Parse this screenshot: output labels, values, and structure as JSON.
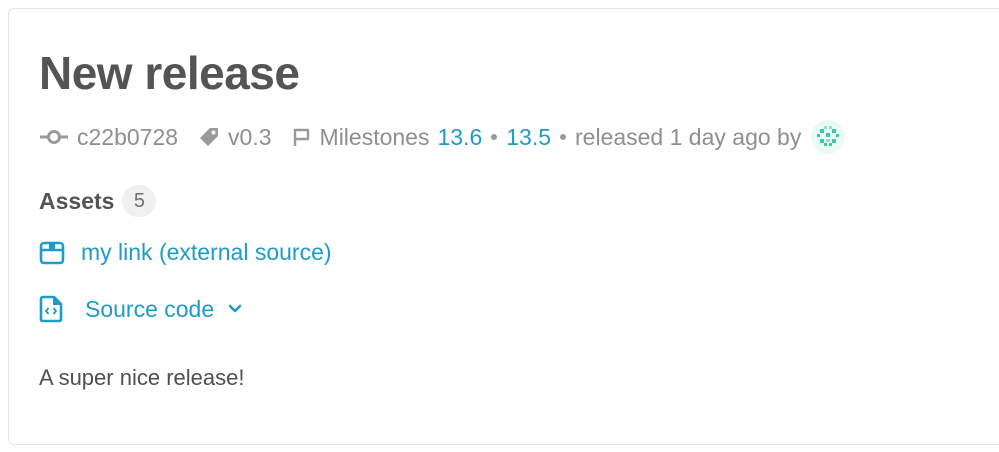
{
  "release": {
    "title": "New release",
    "commit": "c22b0728",
    "tag": "v0.3",
    "milestones_label": "Milestones",
    "milestones": [
      "13.6",
      "13.5"
    ],
    "released_text": "released 1 day ago by",
    "description": "A super nice release!"
  },
  "assets": {
    "heading": "Assets",
    "count": "5",
    "links": [
      {
        "label": "my link (external source)",
        "icon": "package-icon"
      },
      {
        "label": "Source code",
        "icon": "doc-code-icon",
        "dropdown": true
      }
    ]
  },
  "colors": {
    "link": "#1f9bc7",
    "muted": "#8f8f8f",
    "heading": "#545454"
  }
}
